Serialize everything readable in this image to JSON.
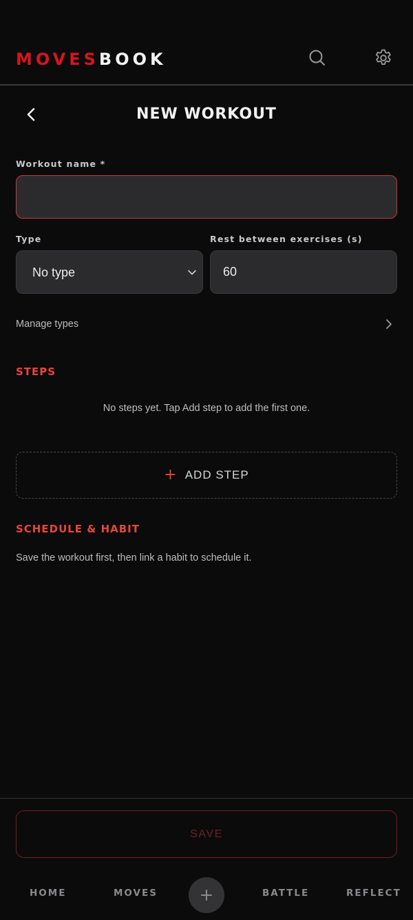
{
  "app": {
    "logo_part1": "MOVES",
    "logo_part2": "BOOK"
  },
  "header": {
    "title": "NEW WORKOUT",
    "icons": [
      "search-icon",
      "gear-icon",
      "back-chevron-icon"
    ]
  },
  "form": {
    "workout_name_label": "Workout name *",
    "workout_name_value": "",
    "type_label": "Type",
    "type_value": "No type",
    "rest_label": "Rest between exercises (s)",
    "rest_value": "60",
    "manage_types_label": "Manage types"
  },
  "steps": {
    "title": "STEPS",
    "empty_text": "No steps yet. Tap Add step to add the first one.",
    "add_step_label": "ADD STEP",
    "add_icon": "+"
  },
  "schedule": {
    "title": "SCHEDULE & HABIT",
    "text": "Save the workout first, then link a habit to schedule it."
  },
  "actions": {
    "save_label": "SAVE"
  },
  "tabbar": {
    "tabs": [
      "HOME",
      "MOVES",
      "BATTLE",
      "REFLECT"
    ],
    "fab_icon": "+"
  },
  "colors": {
    "accent_red": "#d8141b",
    "section_red": "#e8453c",
    "background": "#0b0b0c",
    "input_bg": "#2b2b2e"
  }
}
